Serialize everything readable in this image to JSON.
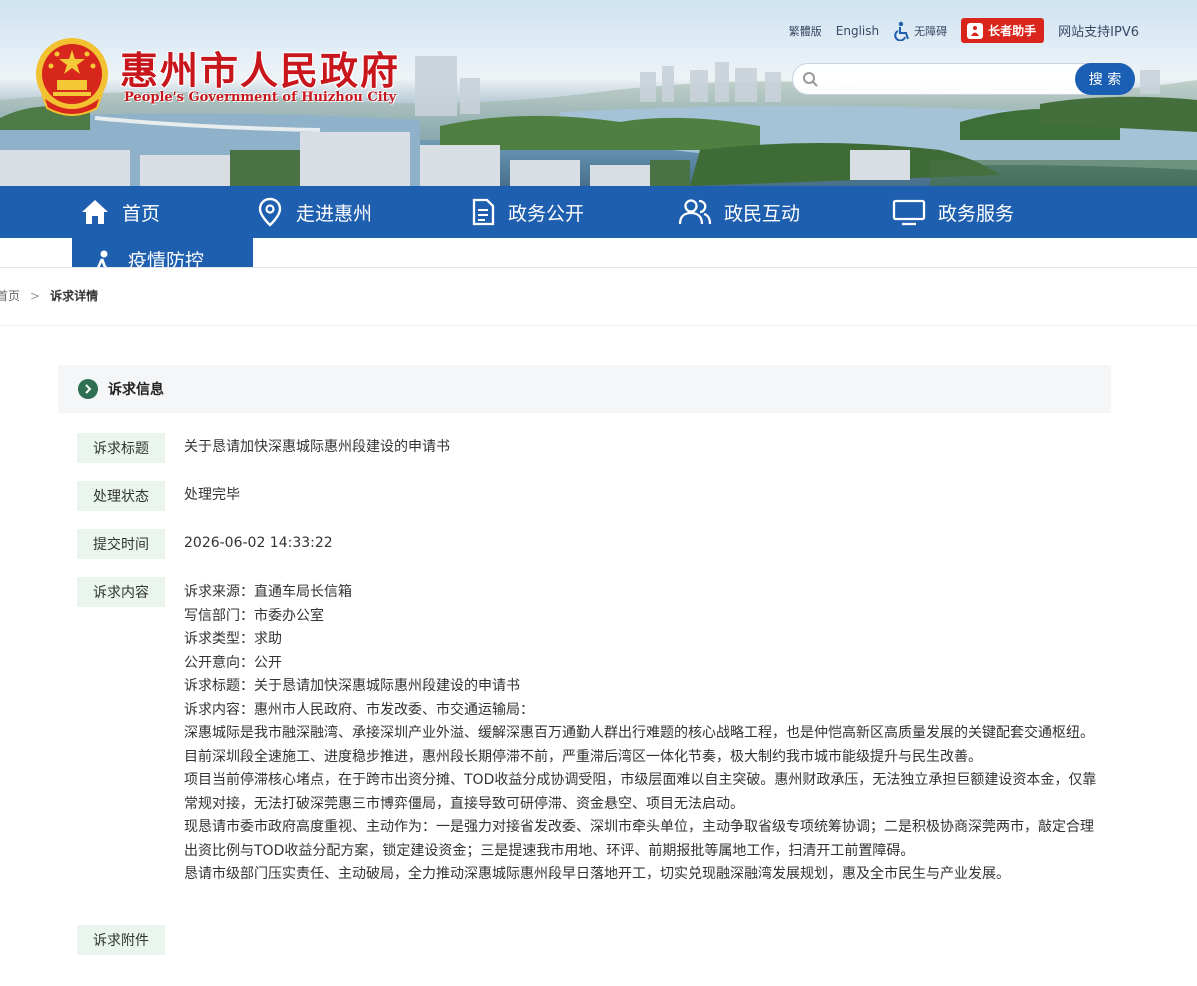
{
  "header": {
    "site_title": "惠州市人民政府",
    "site_subtitle": "People's Government of Huizhou City",
    "links": {
      "traditional": "繁體版",
      "english": "English",
      "accessible": "无障碍",
      "elder_helper": "长者助手",
      "ipv6": "网站支持IPV6"
    },
    "search": {
      "placeholder": "",
      "button": "搜 索"
    }
  },
  "nav": {
    "items": [
      {
        "label": "首页",
        "icon": "home-icon"
      },
      {
        "label": "走进惠州",
        "icon": "location-pin-icon"
      },
      {
        "label": "政务公开",
        "icon": "document-icon"
      },
      {
        "label": "政民互动",
        "icon": "people-icon"
      },
      {
        "label": "政务服务",
        "icon": "monitor-icon"
      }
    ],
    "sub_item": {
      "label": "疫情防控",
      "icon": "person-running-icon"
    }
  },
  "breadcrumb": {
    "home": "首页",
    "separator": ">",
    "current": "诉求详情"
  },
  "section": {
    "title": "诉求信息"
  },
  "fields": {
    "title": {
      "label": "诉求标题",
      "value": "关于恳请加快深惠城际惠州段建设的申请书"
    },
    "status": {
      "label": "处理状态",
      "value": "处理完毕"
    },
    "time": {
      "label": "提交时间",
      "value": "2026-06-02 14:33:22"
    },
    "content": {
      "label": "诉求内容"
    },
    "attachment": {
      "label": "诉求附件"
    }
  },
  "content": {
    "lines": [
      "诉求来源：直通车局长信箱",
      "写信部门：市委办公室",
      "诉求类型：求助",
      "公开意向：公开",
      "诉求标题：关于恳请加快深惠城际惠州段建设的申请书",
      "诉求内容：惠州市人民政府、市发改委、市交通运输局："
    ],
    "paragraphs": [
      "深惠城际是我市融深融湾、承接深圳产业外溢、缓解深惠百万通勤人群出行难题的核心战略工程，也是仲恺高新区高质量发展的关键配套交通枢纽。目前深圳段全速施工、进度稳步推进，惠州段长期停滞不前，严重滞后湾区一体化节奏，极大制约我市城市能级提升与民生改善。",
      "项目当前停滞核心堵点，在于跨市出资分摊、TOD收益分成协调受阻，市级层面难以自主突破。惠州财政承压，无法独立承担巨额建设资本金，仅靠常规对接，无法打破深莞惠三市博弈僵局，直接导致可研停滞、资金悬空、项目无法启动。",
      "现恳请市委市政府高度重视、主动作为：一是强力对接省发改委、深圳市牵头单位，主动争取省级专项统筹协调；二是积极协商深莞两市，敲定合理出资比例与TOD收益分配方案，锁定建设资金；三是提速我市用地、环评、前期报批等属地工作，扫清开工前置障碍。",
      "恳请市级部门压实责任、主动破局，全力推动深惠城际惠州段早日落地开工，切实兑现融深融湾发展规划，惠及全市民生与产业发展。"
    ]
  },
  "colors": {
    "nav_blue": "#1f5fb0",
    "title_red": "#c8161d",
    "label_bg": "#eaf5ee",
    "section_icon": "#2f6f52"
  }
}
